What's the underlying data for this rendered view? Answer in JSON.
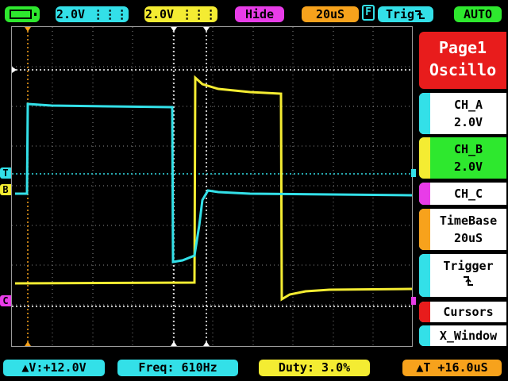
{
  "header": {
    "ch_a_volts": "2.0V",
    "ch_a_coupling": "⎓",
    "ch_b_volts": "2.0V",
    "ch_b_coupling": "⎓",
    "hide": "Hide",
    "timebase": "20uS",
    "f_box": "F",
    "trigger": "Trig",
    "trigger_edge_icon": "falling-edge",
    "mode": "AUTO"
  },
  "markers": {
    "trigger_level": "T",
    "ch_b": "B",
    "ch_c": "C"
  },
  "menu": {
    "page_title_1": "Page1",
    "page_title_2": "Oscillo",
    "items": [
      {
        "line1": "CH_A",
        "line2": "2.0V"
      },
      {
        "line1": "CH_B",
        "line2": "2.0V"
      },
      {
        "line1": "CH_C",
        "line2": ""
      },
      {
        "line1": "TimeBase",
        "line2": "20uS"
      },
      {
        "line1": "Trigger",
        "line2": "ƒ"
      },
      {
        "line1": "Cursors",
        "line2": ""
      },
      {
        "line1": "X_Window",
        "line2": ""
      }
    ]
  },
  "footer": {
    "delta_v": "▲V:+12.0V",
    "freq": "Freq: 610Hz",
    "duty": "Duty: 3.0%",
    "delta_t": "▲T +16.0uS"
  },
  "colors": {
    "ch_a": "#33e0e8",
    "ch_b": "#f4ec32",
    "ch_c": "#e83ce8",
    "orange": "#f7a21c",
    "green": "#2ee82e",
    "red": "#e81c1c"
  }
}
